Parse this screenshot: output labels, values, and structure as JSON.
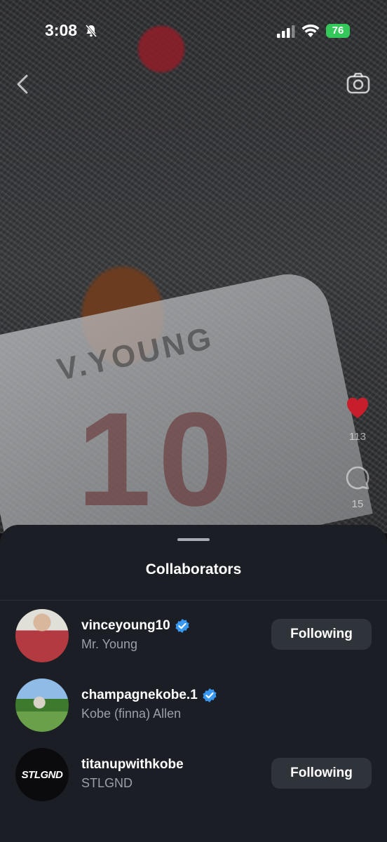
{
  "status_bar": {
    "time": "3:08",
    "battery": "76"
  },
  "video": {
    "jersey_text": "V.YOUNG",
    "jersey_number": "10"
  },
  "actions": {
    "likes": "113",
    "comments": "15"
  },
  "sheet": {
    "title": "Collaborators",
    "collaborators": [
      {
        "username": "vinceyoung10",
        "name": "Mr. Young",
        "verified": true,
        "button": "Following"
      },
      {
        "username": "champagnekobe.1",
        "name": "Kobe (finna) Allen",
        "verified": true,
        "button": ""
      },
      {
        "username": "titanupwithkobe",
        "name": "STLGND",
        "verified": false,
        "button": "Following",
        "avatar_text": "STLGND"
      }
    ]
  },
  "colors": {
    "like": "#c81d2b",
    "verified": "#3897f0",
    "battery": "#34c759"
  }
}
